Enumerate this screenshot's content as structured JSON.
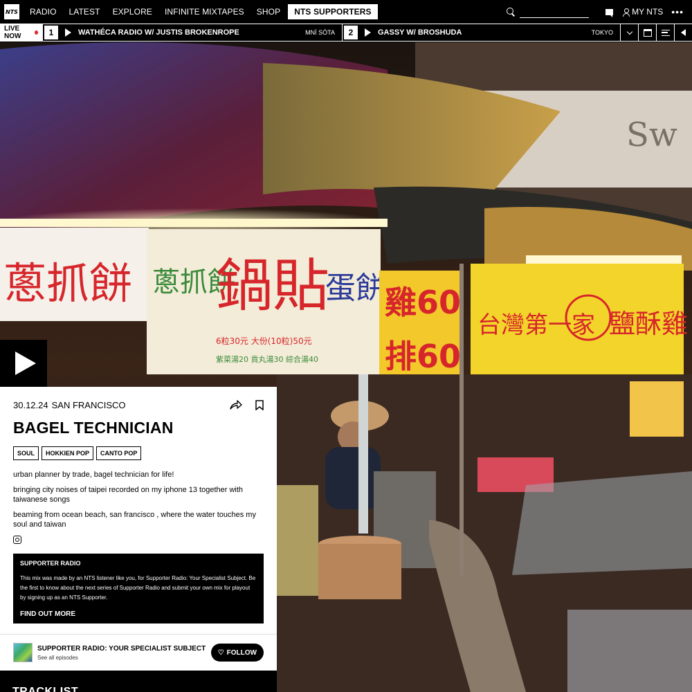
{
  "nav": {
    "logo": "NTS",
    "items": [
      "RADIO",
      "LATEST",
      "EXPLORE",
      "INFINITE MIXTAPES",
      "SHOP"
    ],
    "supporters": "NTS SUPPORTERS",
    "search_placeholder": "",
    "my_nts": "MY NTS",
    "more": "•••"
  },
  "live": {
    "label": "LIVE NOW",
    "channels": [
      {
        "number": "1",
        "title": "WATHÉCA RADIO W/ JUSTIS BROKENROPE",
        "location": "MNÍ SÓTA"
      },
      {
        "number": "2",
        "title": "GASSY W/ BROSHUDA",
        "location": "TOKYO"
      }
    ]
  },
  "episode": {
    "date": "30.12.24",
    "location": "SAN FRANCISCO",
    "title": "BAGEL TECHNICIAN",
    "tags": [
      "SOUL",
      "HOKKIEN POP",
      "CANTO POP"
    ],
    "description": [
      "urban planner by trade, bagel technician for life!",
      "bringing city noises of taipei recorded on my iphone 13 together with taiwanese songs",
      "beaming from ocean beach, san francisco , where the water touches my soul and taiwan"
    ]
  },
  "supporter_box": {
    "title": "SUPPORTER RADIO",
    "text": "This mix was made by an NTS listener like you, for Supporter Radio: Your Specialist Subject. Be the first to know about the next series of Supporter Radio and submit your own mix for playout by signing up as an NTS Supporter.",
    "link": "FIND OUT MORE"
  },
  "show": {
    "name": "SUPPORTER RADIO: YOUR SPECIALIST SUBJECT",
    "sub": "See all episodes",
    "follow": "FOLLOW"
  },
  "tracklist": "TRACKLIST",
  "colors": {
    "live_dot": "#e0292f",
    "sign_red": "#d7262b",
    "sign_yellow": "#f3d42a"
  }
}
